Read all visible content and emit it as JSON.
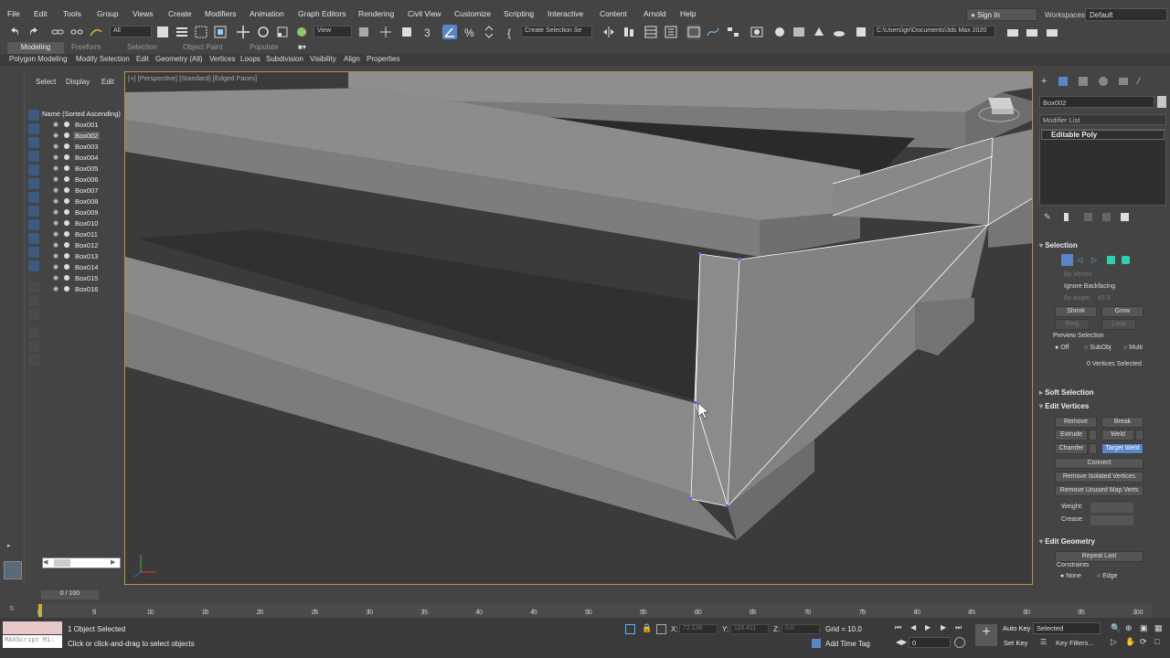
{
  "menu": {
    "items": [
      "File",
      "Edit",
      "Tools",
      "Group",
      "Views",
      "Create",
      "Modifiers",
      "Animation",
      "Graph Editors",
      "Rendering",
      "Civil View",
      "Customize",
      "Scripting",
      "Interactive",
      "Content",
      "Arnold",
      "Help"
    ],
    "sign_in": "Sign In",
    "workspaces_label": "Workspaces:",
    "workspace_value": "Default"
  },
  "toolbar": {
    "filter_value": "All",
    "view_value": "View",
    "create_selection_set": "Create Selection Se",
    "project_path": "C:\\Users\\gir\\Documents\\3ds Max 2020"
  },
  "ribbon": {
    "tabs": [
      "Modeling",
      "Freeform",
      "Selection",
      "Object Paint",
      "Populate"
    ],
    "panels": [
      "Polygon Modeling",
      "Modify Selection",
      "Edit",
      "Geometry (All)",
      "Vertices",
      "Loops",
      "Subdivision",
      "Visibility",
      "Align",
      "Properties"
    ]
  },
  "scene_explorer": {
    "tabs": [
      "Select",
      "Display",
      "Edit"
    ],
    "header": "Name (Sorted Ascending)",
    "objects": [
      "Box001",
      "Box002",
      "Box003",
      "Box004",
      "Box005",
      "Box006",
      "Box007",
      "Box008",
      "Box009",
      "Box010",
      "Box011",
      "Box012",
      "Box013",
      "Box014",
      "Box015",
      "Box016"
    ],
    "selected": "Box002"
  },
  "viewport": {
    "label": "[+] [Perspective] [Standard] [Edged Faces]"
  },
  "command_panel": {
    "object_name": "Box002",
    "modifier_list": "Modifier List",
    "stack_item": "Editable Poly",
    "selection": {
      "title": "Selection",
      "by_vertex": "By Vertex",
      "ignore_backfacing": "Ignore Backfacing",
      "by_angle": "By Angle:",
      "angle_value": "45.0",
      "shrink": "Shrink",
      "grow": "Grow",
      "ring": "Ring",
      "loop": "Loop",
      "preview_selection": "Preview Selection",
      "off": "Off",
      "subobj": "SubObj",
      "multi": "Multi",
      "status": "0 Vertices Selected"
    },
    "soft_selection": "Soft Selection",
    "edit_vertices": {
      "title": "Edit Vertices",
      "remove": "Remove",
      "break": "Break",
      "extrude": "Extrude",
      "weld": "Weld",
      "chamfer": "Chamfer",
      "target_weld": "Target Weld",
      "connect": "Connect",
      "remove_isolated": "Remove Isolated Vertices",
      "remove_unused": "Remove Unused Map Verts",
      "weight": "Weight:",
      "crease": "Crease:"
    },
    "edit_geometry": {
      "title": "Edit Geometry",
      "repeat_last": "Repeat Last",
      "constraints": "Constraints",
      "none": "None",
      "edge": "Edge"
    }
  },
  "timeline": {
    "frame_label": "0 / 100",
    "ticks": [
      "0",
      "5",
      "10",
      "15",
      "20",
      "25",
      "30",
      "35",
      "40",
      "45",
      "50",
      "55",
      "60",
      "65",
      "70",
      "75",
      "80",
      "85",
      "90",
      "95",
      "100"
    ]
  },
  "status": {
    "maxscript": "MAXScript Mi:",
    "objects_selected": "1 Object Selected",
    "prompt": "Click or click-and-drag to select objects",
    "x_label": "X:",
    "x_value": "72.138",
    "y_label": "Y:",
    "y_value": "116.411",
    "z_label": "Z:",
    "z_value": "0.0",
    "grid": "Grid = 10.0",
    "add_time_tag": "Add Time Tag",
    "auto_key": "Auto Key",
    "set_key": "Set Key",
    "selected_dropdown": "Selected",
    "key_filters": "Key Filters...",
    "frame_value": "0"
  },
  "colors": {
    "accent": "#5a85c8",
    "viewport_border": "#b39a3a",
    "background": "#444444"
  }
}
